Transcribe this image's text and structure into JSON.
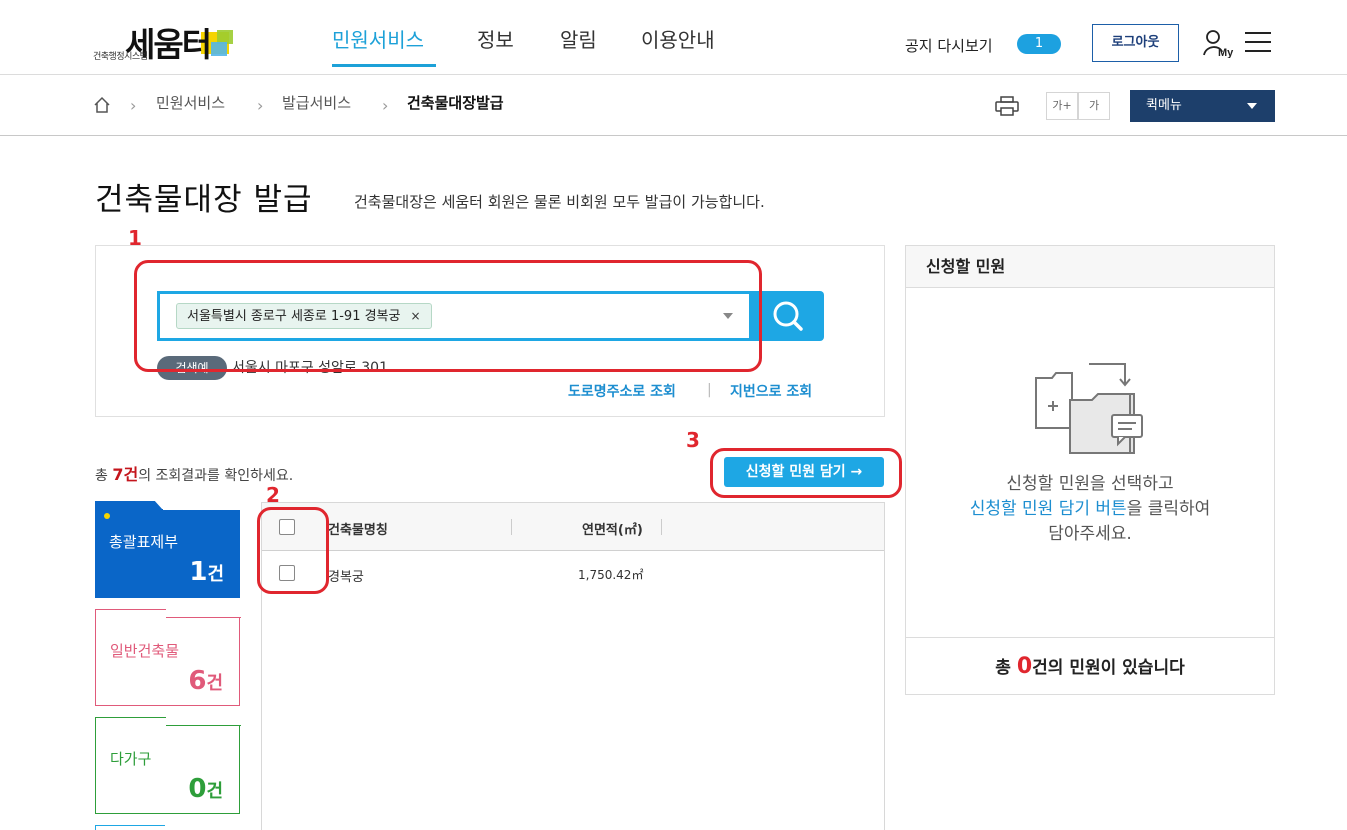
{
  "header": {
    "logo_sub": "건축행정시스템",
    "logo_main": "세움터",
    "nav": [
      "민원서비스",
      "정보",
      "알림",
      "이용안내"
    ],
    "notice_label": "공지 다시보기",
    "notice_count": "1",
    "logout_label": "로그아웃",
    "my_label": "My",
    "icons": [
      "my-page-icon",
      "hamburger-menu-icon"
    ]
  },
  "breadcrumb": {
    "items": [
      "민원서비스",
      "발급서비스",
      "건축물대장발급"
    ],
    "font_up": "가+",
    "font_down": "가",
    "quickmenu": "퀵메뉴"
  },
  "page": {
    "title": "건축물대장 발급",
    "description": "건축물대장은 세움터 회원은 물론 비회원 모두 발급이 가능합니다."
  },
  "annotations": [
    "1",
    "2",
    "3"
  ],
  "search": {
    "tag": "서울특별시 종로구 세종로 1-91 경복궁",
    "tag_remove": "×",
    "example_badge": "검색예",
    "example_text": "서울시 마포구 성암로 301",
    "link_road": "도로명주소로 조회",
    "link_lot": "지번으로 조회"
  },
  "results": {
    "count_prefix": "총 ",
    "count": "7건",
    "count_suffix": "의 조회결과를 확인하세요.",
    "add_button": "신청할 민원 담기 →",
    "categories": [
      {
        "label": "총괄표제부",
        "count": "1",
        "unit": "건"
      },
      {
        "label": "일반건축물",
        "count": "6",
        "unit": "건"
      },
      {
        "label": "다가구",
        "count": "0",
        "unit": "건"
      }
    ],
    "columns": [
      "건축물명칭",
      "연면적(㎡)"
    ],
    "rows": [
      {
        "name": "경복궁",
        "area": "1,750.42㎡"
      }
    ]
  },
  "side": {
    "title": "신청할 민원",
    "msg_line1": "신청할 민원을 선택하고",
    "msg_blue": "신청할 민원 담기 버튼",
    "msg_after": "을 클릭하여",
    "msg_line3": "담아주세요.",
    "foot_prefix": "총 ",
    "foot_count": "0",
    "foot_suffix": "건의 민원이 있습니다"
  },
  "colors": {
    "accent": "#1ea7e4",
    "annotation": "#e0262e",
    "navy": "#1d3f6b",
    "category_active": "#0a66c8",
    "category_general": "#e05a7a",
    "category_multi": "#2e9e3a"
  }
}
